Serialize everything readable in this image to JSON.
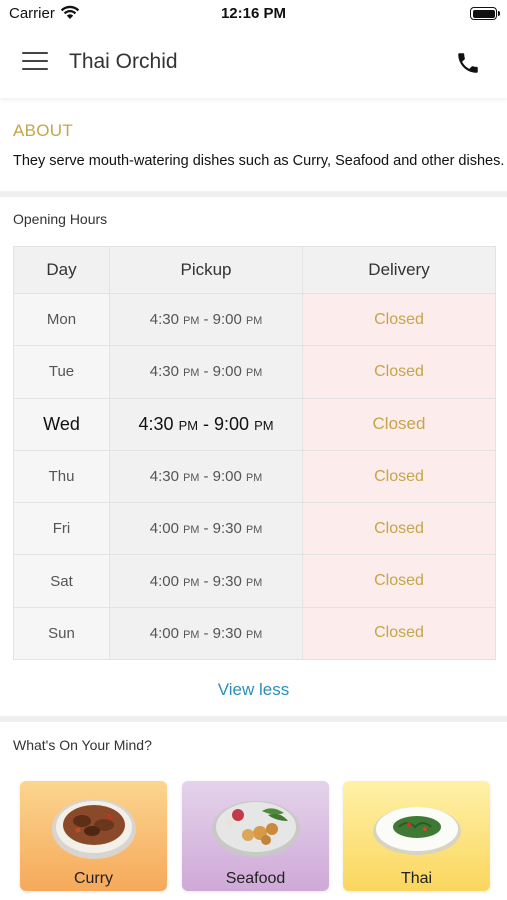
{
  "status_bar": {
    "carrier": "Carrier",
    "time": "12:16 PM"
  },
  "header": {
    "title": "Thai Orchid",
    "menu_icon": "hamburger-menu-icon",
    "phone_icon": "phone-icon"
  },
  "about": {
    "heading": "ABOUT",
    "text": "They serve mouth-watering dishes such as Curry, Seafood and other dishes."
  },
  "hours": {
    "heading": "Opening Hours",
    "columns": [
      "Day",
      "Pickup",
      "Delivery"
    ],
    "rows": [
      {
        "day": "Mon",
        "open": "4:30",
        "open_ampm": "PM",
        "close": "9:00",
        "close_ampm": "PM",
        "delivery": "Closed"
      },
      {
        "day": "Tue",
        "open": "4:30",
        "open_ampm": "PM",
        "close": "9:00",
        "close_ampm": "PM",
        "delivery": "Closed"
      },
      {
        "day": "Wed",
        "open": "4:30",
        "open_ampm": "PM",
        "close": "9:00",
        "close_ampm": "PM",
        "delivery": "Closed"
      },
      {
        "day": "Thu",
        "open": "4:30",
        "open_ampm": "PM",
        "close": "9:00",
        "close_ampm": "PM",
        "delivery": "Closed"
      },
      {
        "day": "Fri",
        "open": "4:00",
        "open_ampm": "PM",
        "close": "9:30",
        "close_ampm": "PM",
        "delivery": "Closed"
      },
      {
        "day": "Sat",
        "open": "4:00",
        "open_ampm": "PM",
        "close": "9:30",
        "close_ampm": "PM",
        "delivery": "Closed"
      },
      {
        "day": "Sun",
        "open": "4:00",
        "open_ampm": "PM",
        "close": "9:30",
        "close_ampm": "PM",
        "delivery": "Closed"
      }
    ],
    "view_less": "View less"
  },
  "mind": {
    "heading": "What's On Your Mind?",
    "categories": [
      {
        "label": "Curry"
      },
      {
        "label": "Seafood"
      },
      {
        "label": "Thai"
      }
    ]
  },
  "colors": {
    "accent_gold": "#c4a54a",
    "link_blue": "#2a8fb8",
    "closed_bg": "#fdecec"
  }
}
